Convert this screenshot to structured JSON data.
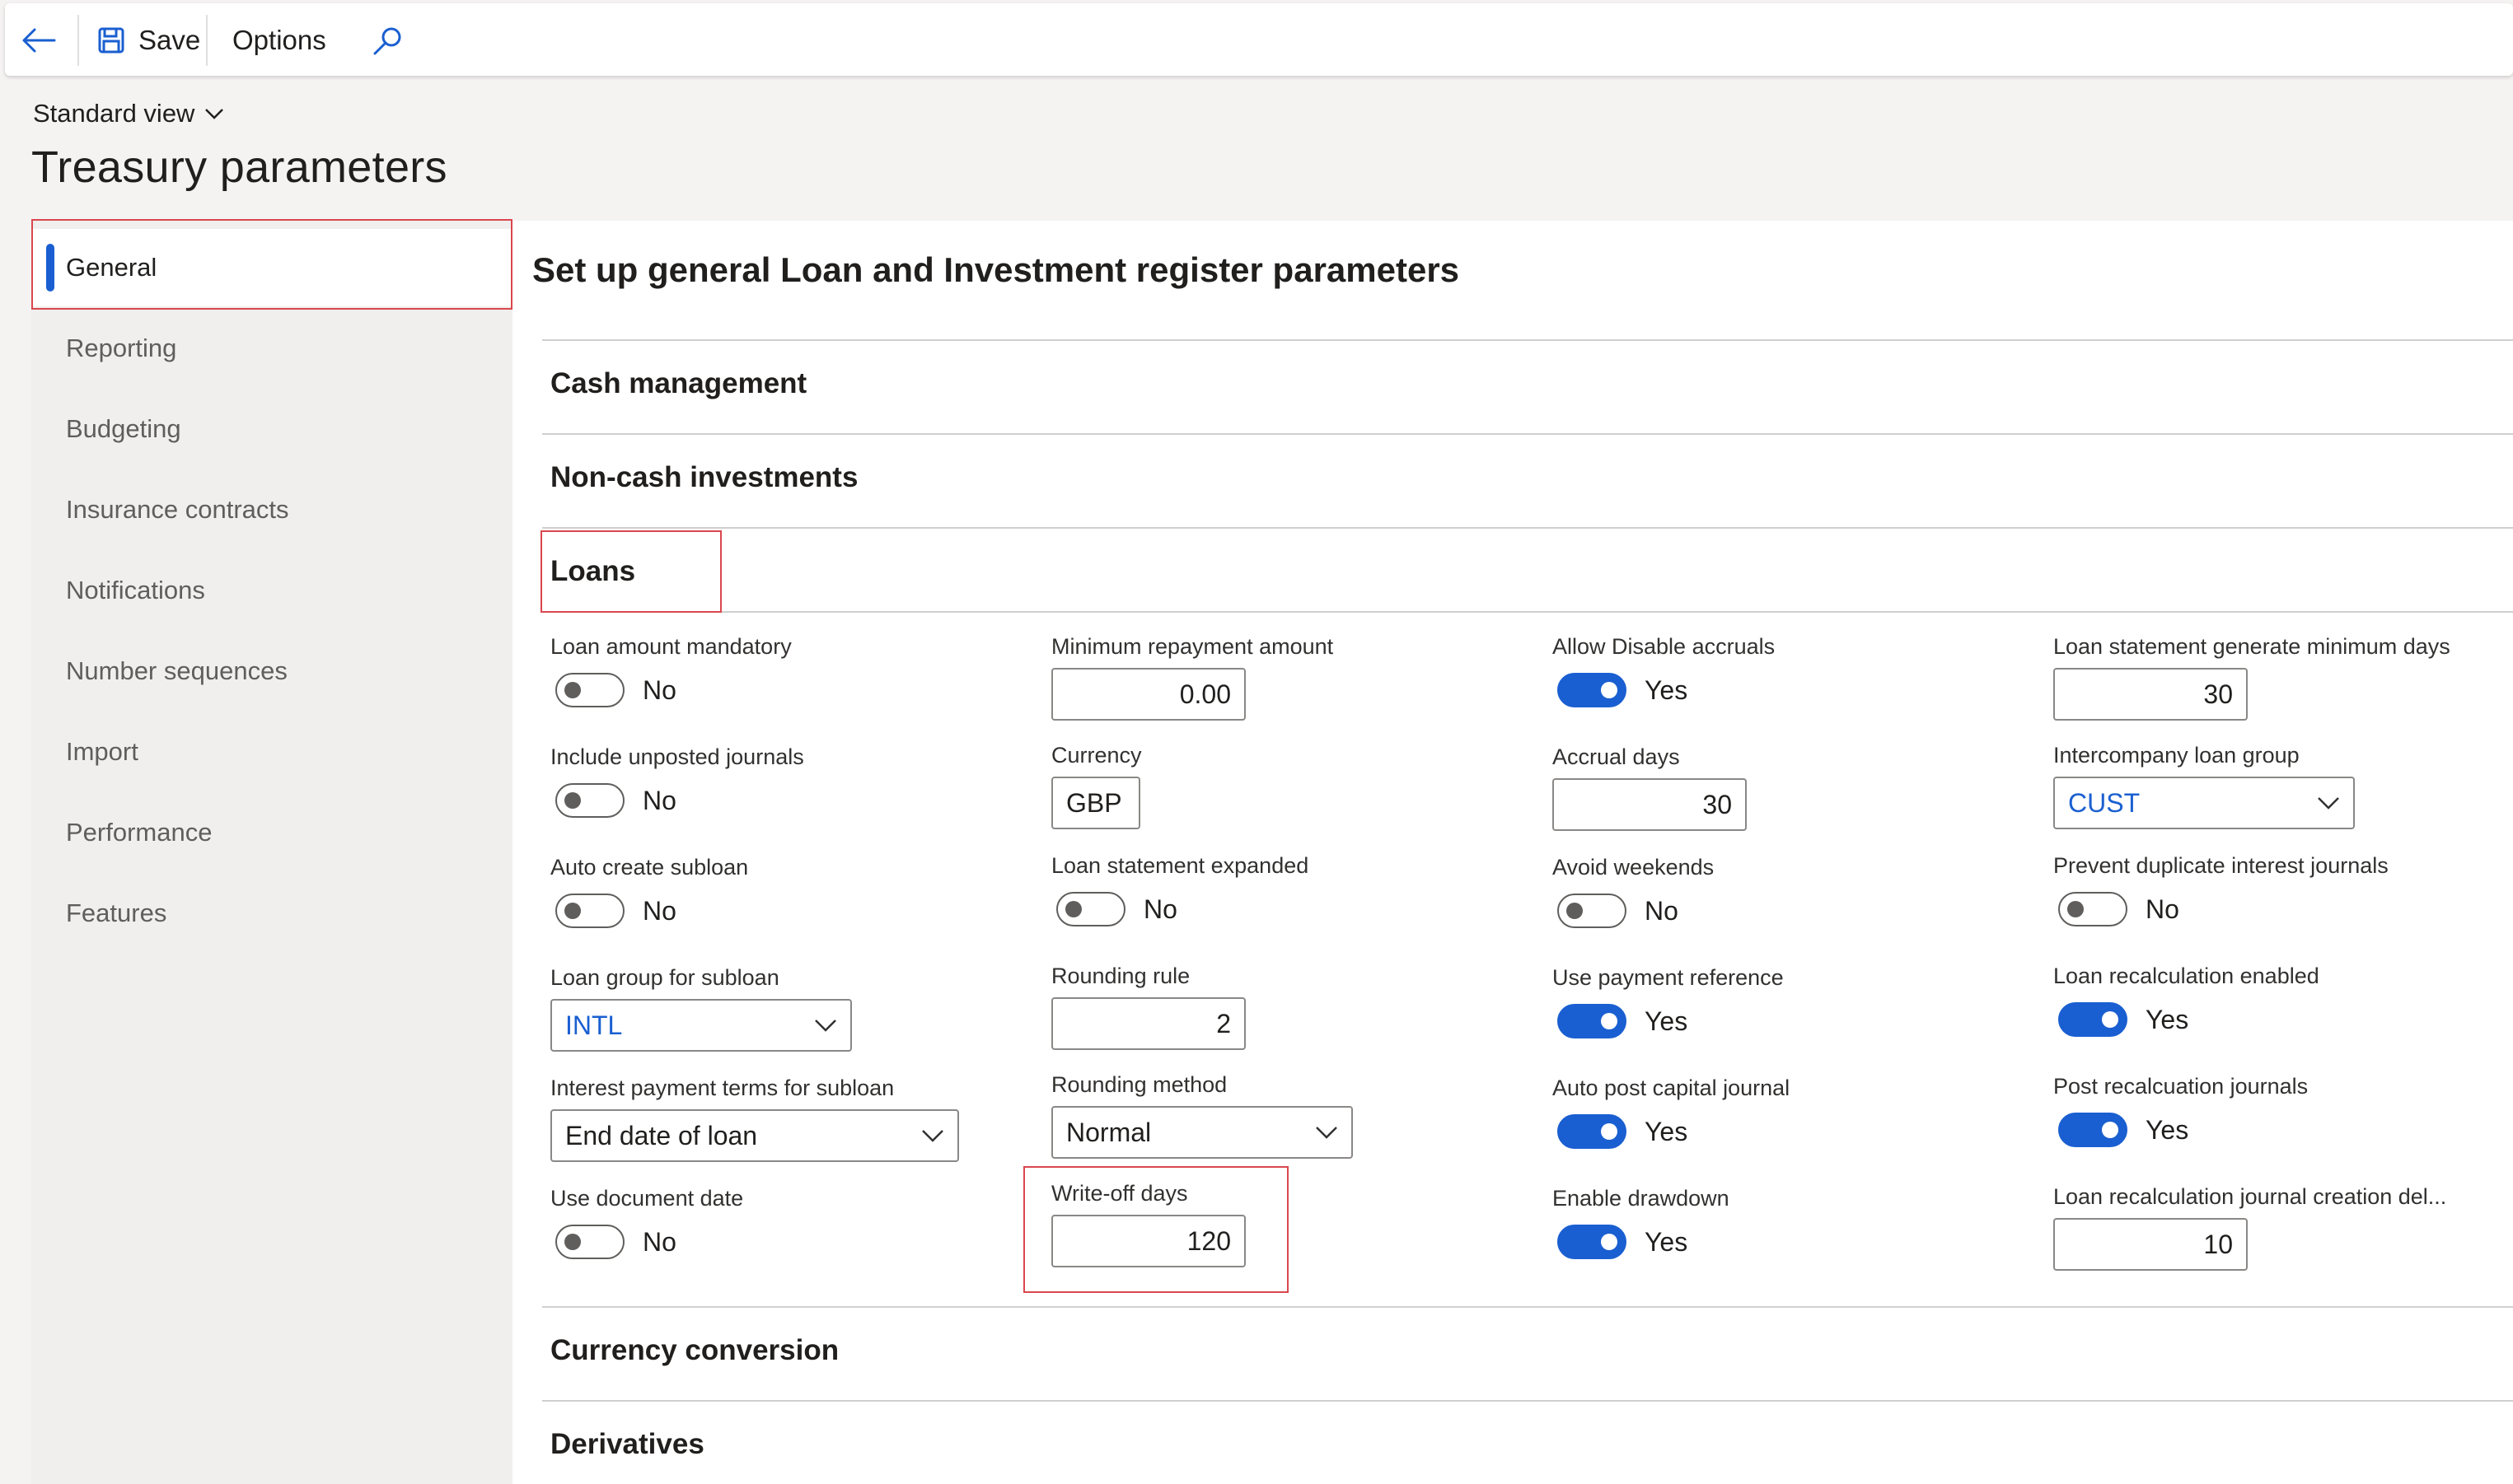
{
  "toolbar": {
    "save_label": "Save",
    "options_label": "Options",
    "icons": [
      "back-arrow-icon",
      "save-icon",
      "search-icon"
    ]
  },
  "header": {
    "view_label": "Standard view",
    "title": "Treasury parameters"
  },
  "sidebar": {
    "items": [
      {
        "label": "General",
        "active": true
      },
      {
        "label": "Reporting"
      },
      {
        "label": "Budgeting"
      },
      {
        "label": "Insurance contracts"
      },
      {
        "label": "Notifications"
      },
      {
        "label": "Number sequences"
      },
      {
        "label": "Import"
      },
      {
        "label": "Performance"
      },
      {
        "label": "Features"
      }
    ]
  },
  "main": {
    "heading": "Set up general Loan and Investment register parameters",
    "sections": {
      "cash_management": "Cash management",
      "non_cash": "Non-cash investments",
      "loans": "Loans",
      "currency_conversion": "Currency conversion",
      "derivatives": "Derivatives"
    }
  },
  "loans": {
    "loan_amount_mandatory": {
      "label": "Loan amount mandatory",
      "value": "No"
    },
    "include_unposted": {
      "label": "Include unposted journals",
      "value": "No"
    },
    "auto_create_subloan": {
      "label": "Auto create subloan",
      "value": "No"
    },
    "loan_group_subloan": {
      "label": "Loan group for subloan",
      "value": "INTL"
    },
    "interest_terms_subloan": {
      "label": "Interest payment terms for subloan",
      "value": "End date of loan"
    },
    "use_document_date": {
      "label": "Use document date",
      "value": "No"
    },
    "min_repayment": {
      "label": "Minimum repayment amount",
      "value": "0.00"
    },
    "currency": {
      "label": "Currency",
      "value": "GBP"
    },
    "statement_expanded": {
      "label": "Loan statement expanded",
      "value": "No"
    },
    "rounding_rule": {
      "label": "Rounding rule",
      "value": "2"
    },
    "rounding_method": {
      "label": "Rounding method",
      "value": "Normal"
    },
    "writeoff_days": {
      "label": "Write-off days",
      "value": "120"
    },
    "allow_disable_accruals": {
      "label": "Allow Disable accruals",
      "value": "Yes"
    },
    "accrual_days": {
      "label": "Accrual days",
      "value": "30"
    },
    "avoid_weekends": {
      "label": "Avoid weekends",
      "value": "No"
    },
    "use_payment_reference": {
      "label": "Use payment reference",
      "value": "Yes"
    },
    "auto_post_capital": {
      "label": "Auto post capital journal",
      "value": "Yes"
    },
    "enable_drawdown": {
      "label": "Enable drawdown",
      "value": "Yes"
    },
    "statement_min_days": {
      "label": "Loan statement generate minimum days",
      "value": "30"
    },
    "intercompany_group": {
      "label": "Intercompany loan group",
      "value": "CUST"
    },
    "prevent_duplicate": {
      "label": "Prevent duplicate interest journals",
      "value": "No"
    },
    "recalc_enabled": {
      "label": "Loan recalculation enabled",
      "value": "Yes"
    },
    "post_recalc": {
      "label": "Post recalcuation journals",
      "value": "Yes"
    },
    "recalc_delay": {
      "label": "Loan recalculation journal creation del...",
      "value": "10"
    }
  },
  "colors": {
    "accent": "#1a5fd1",
    "highlight": "#d9474e"
  }
}
